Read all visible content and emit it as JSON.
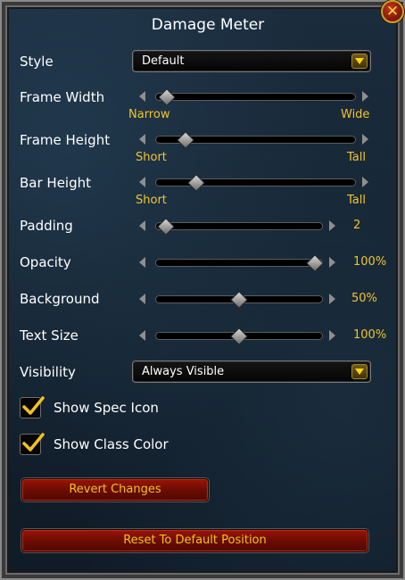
{
  "window": {
    "title": "Damage Meter",
    "close_icon_glyph": "✕"
  },
  "settings": {
    "style": {
      "label": "Style",
      "value": "Default"
    },
    "frame_width": {
      "label": "Frame Width",
      "min_label": "Narrow",
      "max_label": "Wide",
      "level": 0.02
    },
    "frame_height": {
      "label": "Frame Height",
      "min_label": "Short",
      "max_label": "Tall",
      "level": 0.12
    },
    "bar_height": {
      "label": "Bar Height",
      "min_label": "Short",
      "max_label": "Tall",
      "level": 0.18
    },
    "padding": {
      "label": "Padding",
      "value_text": "2",
      "level": 0.02
    },
    "opacity": {
      "label": "Opacity",
      "value_text": "100%",
      "level": 1.0
    },
    "background": {
      "label": "Background",
      "value_text": "50%",
      "level": 0.5
    },
    "text_size": {
      "label": "Text Size",
      "value_text": "100%",
      "level": 0.5
    },
    "visibility": {
      "label": "Visibility",
      "value": "Always Visible"
    }
  },
  "checkboxes": {
    "show_spec_icon": {
      "label": "Show Spec Icon",
      "checked": true
    },
    "show_class_color": {
      "label": "Show Class Color",
      "checked": true
    }
  },
  "buttons": {
    "revert": "Revert Changes",
    "reset": "Reset To Default Position"
  },
  "colors": {
    "accent_gold": "#f0c530",
    "button_red": "#6b0c02",
    "text_white": "#ffffff"
  }
}
